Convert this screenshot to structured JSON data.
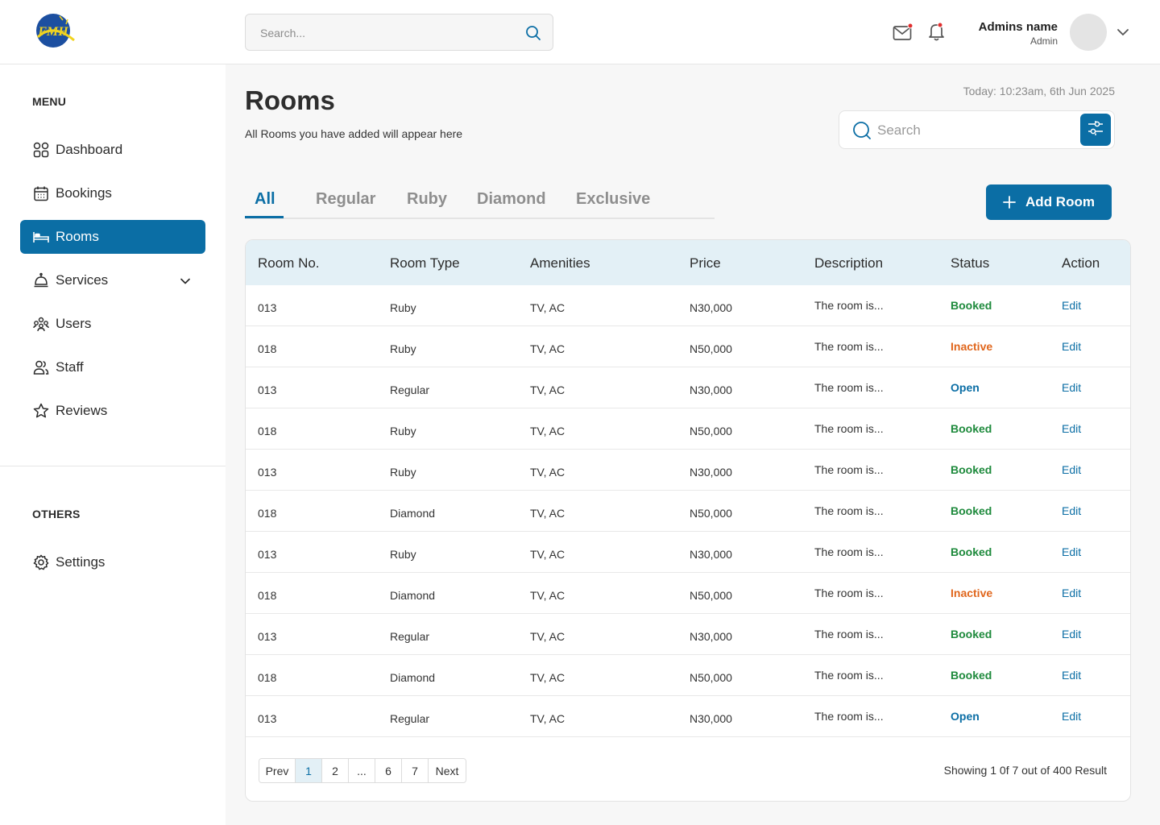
{
  "header": {
    "logo_text": "FMH",
    "search_placeholder": "Search...",
    "admin_name": "Admins name",
    "admin_role": "Admin"
  },
  "sidebar": {
    "menu_label": "MENU",
    "others_label": "OTHERS",
    "items": [
      {
        "label": "Dashboard",
        "icon": "grid-icon"
      },
      {
        "label": "Bookings",
        "icon": "calendar-icon"
      },
      {
        "label": "Rooms",
        "icon": "bed-icon",
        "active": true
      },
      {
        "label": "Services",
        "icon": "cloche-icon",
        "has_dropdown": true
      },
      {
        "label": "Users",
        "icon": "users-icon"
      },
      {
        "label": "Staff",
        "icon": "staff-icon"
      },
      {
        "label": "Reviews",
        "icon": "star-icon"
      }
    ],
    "other_items": [
      {
        "label": "Settings",
        "icon": "gear-icon"
      }
    ]
  },
  "page": {
    "title": "Rooms",
    "subtitle": "All Rooms you have added will appear here",
    "today": "Today: 10:23am, 6th Jun 2025",
    "search_placeholder": "Search",
    "add_button": "Add Room"
  },
  "tabs": [
    "All",
    "Regular",
    "Ruby",
    "Diamond",
    "Exclusive"
  ],
  "active_tab": "All",
  "table": {
    "columns": [
      "Room No.",
      "Room Type",
      "Amenities",
      "Price",
      "Description",
      "Status",
      "Action"
    ],
    "rows": [
      {
        "room": "013",
        "type": "Ruby",
        "amenities": "TV, AC",
        "price": "N30,000",
        "desc": "The room is...",
        "status": "Booked",
        "action": "Edit"
      },
      {
        "room": "018",
        "type": "Ruby",
        "amenities": "TV, AC",
        "price": "N50,000",
        "desc": "The room is...",
        "status": "Inactive",
        "action": "Edit"
      },
      {
        "room": "013",
        "type": "Regular",
        "amenities": "TV, AC",
        "price": "N30,000",
        "desc": "The room is...",
        "status": "Open",
        "action": "Edit"
      },
      {
        "room": "018",
        "type": "Ruby",
        "amenities": "TV, AC",
        "price": "N50,000",
        "desc": "The room is...",
        "status": "Booked",
        "action": "Edit"
      },
      {
        "room": "013",
        "type": "Ruby",
        "amenities": "TV, AC",
        "price": "N30,000",
        "desc": "The room is...",
        "status": "Booked",
        "action": "Edit"
      },
      {
        "room": "018",
        "type": "Diamond",
        "amenities": "TV, AC",
        "price": "N50,000",
        "desc": "The room is...",
        "status": "Booked",
        "action": "Edit"
      },
      {
        "room": "013",
        "type": "Ruby",
        "amenities": "TV, AC",
        "price": "N30,000",
        "desc": "The room is...",
        "status": "Booked",
        "action": "Edit"
      },
      {
        "room": "018",
        "type": "Diamond",
        "amenities": "TV, AC",
        "price": "N50,000",
        "desc": "The room is...",
        "status": "Inactive",
        "action": "Edit"
      },
      {
        "room": "013",
        "type": "Regular",
        "amenities": "TV, AC",
        "price": "N30,000",
        "desc": "The room is...",
        "status": "Booked",
        "action": "Edit"
      },
      {
        "room": "018",
        "type": "Diamond",
        "amenities": "TV, AC",
        "price": "N50,000",
        "desc": "The room is...",
        "status": "Booked",
        "action": "Edit"
      },
      {
        "room": "013",
        "type": "Regular",
        "amenities": "TV, AC",
        "price": "N30,000",
        "desc": "The room is...",
        "status": "Open",
        "action": "Edit"
      }
    ]
  },
  "status_colors": {
    "Booked": "#1e8a3c",
    "Inactive": "#e0661c",
    "Open": "#0b6ea5"
  },
  "accent_color": "#0b6ea5",
  "pagination": {
    "prev": "Prev",
    "pages": [
      "1",
      "2",
      "...",
      "6",
      "7"
    ],
    "active_page": "1",
    "next": "Next",
    "summary": "Showing 1 0f 7 out of 400 Result"
  }
}
